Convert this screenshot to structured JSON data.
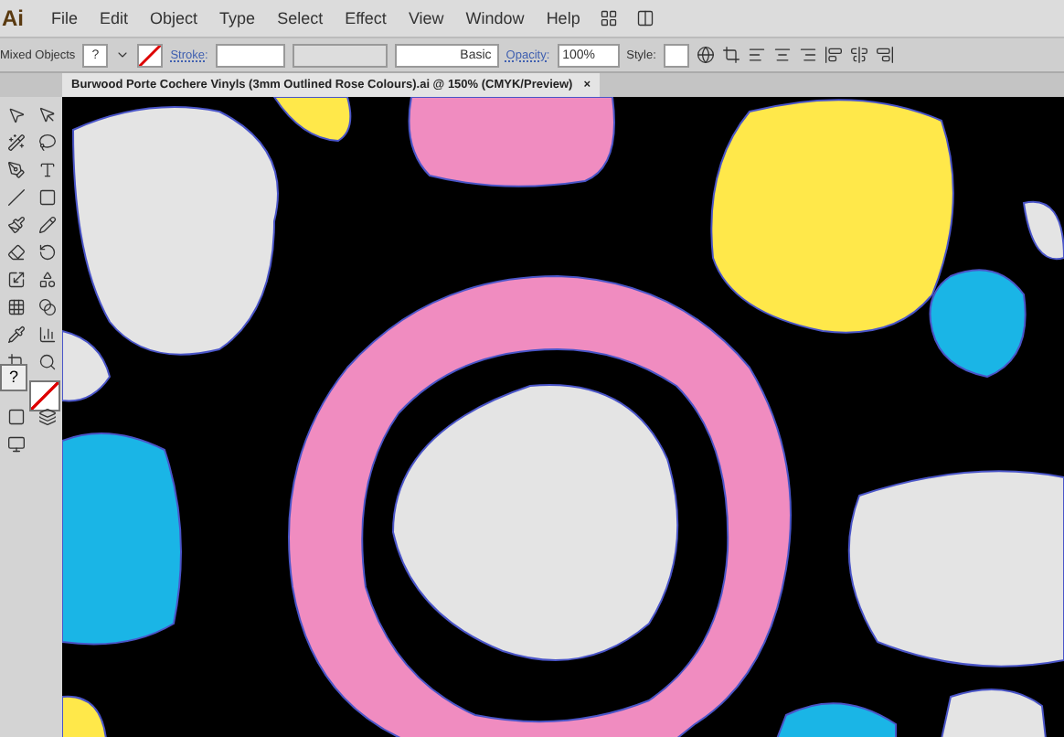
{
  "app": {
    "logo": "Ai"
  },
  "menu": [
    "File",
    "Edit",
    "Object",
    "Type",
    "Select",
    "Effect",
    "View",
    "Window",
    "Help"
  ],
  "control_bar": {
    "selection": "Mixed Objects",
    "fill": "?",
    "stroke_label": "Stroke:",
    "brush": "Basic",
    "opacity_label": "Opacity:",
    "opacity": "100%",
    "style_label": "Style:"
  },
  "document_tab": {
    "title": "Burwood Porte Cochere Vinyls (3mm Outlined Rose Colours).ai @ 150% (CMYK/Preview)",
    "close": "×",
    "selected": true
  },
  "toolbox": {
    "fill": "?"
  }
}
